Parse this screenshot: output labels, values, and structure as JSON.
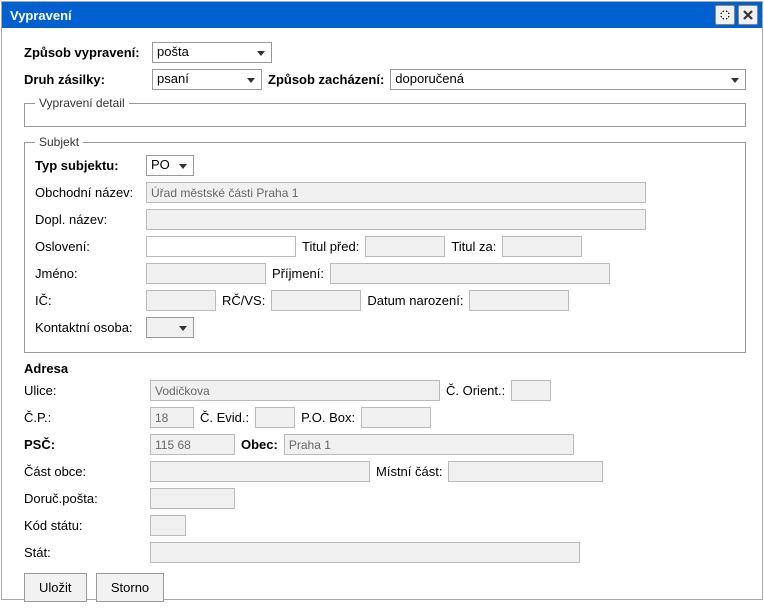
{
  "window": {
    "title": "Vypravení",
    "expand_icon": "expand-icon",
    "close_icon": "close-icon"
  },
  "top": {
    "method_label": "Způsob vypravení:",
    "method_value": "pošta",
    "type_label": "Druh zásilky:",
    "type_value": "psaní",
    "handling_label": "Způsob zacházení:",
    "handling_value": "doporučená"
  },
  "detail": {
    "legend": "Vypravení detail"
  },
  "subject": {
    "legend": "Subjekt",
    "type_label": "Typ subjektu:",
    "type_value": "PO",
    "business_label": "Obchodní název:",
    "business_value": "Úřad městské části Praha 1",
    "addname_label": "Dopl. název:",
    "addname_value": "",
    "salutation_label": "Oslovení:",
    "salutation_value": "",
    "title_before_label": "Titul před:",
    "title_before_value": "",
    "title_after_label": "Titul za:",
    "title_after_value": "",
    "firstname_label": "Jméno:",
    "firstname_value": "",
    "lastname_label": "Příjmení:",
    "lastname_value": "",
    "ic_label": "IČ:",
    "ic_value": "",
    "rcvs_label": "RČ/VS:",
    "rcvs_value": "",
    "birth_label": "Datum narození:",
    "birth_value": "",
    "contact_label": "Kontaktní osoba:",
    "contact_value": ""
  },
  "address": {
    "section": "Adresa",
    "street_label": "Ulice:",
    "street_value": "Vodičkova",
    "orient_label": "Č. Orient.:",
    "orient_value": "",
    "cp_label": "Č.P.:",
    "cp_value": "18",
    "evid_label": "Č. Evid.:",
    "evid_value": "",
    "pobox_label": "P.O. Box:",
    "pobox_value": "",
    "psc_label": "PSČ:",
    "psc_value": "115 68",
    "obec_label": "Obec:",
    "obec_value": "Praha 1",
    "part_label": "Část obce:",
    "part_value": "",
    "mistni_label": "Místní část:",
    "mistni_value": "",
    "delivpost_label": "Doruč.pošta:",
    "delivpost_value": "",
    "statecode_label": "Kód státu:",
    "statecode_value": "",
    "state_label": "Stát:",
    "state_value": ""
  },
  "buttons": {
    "save": "Uložit",
    "cancel": "Storno"
  }
}
